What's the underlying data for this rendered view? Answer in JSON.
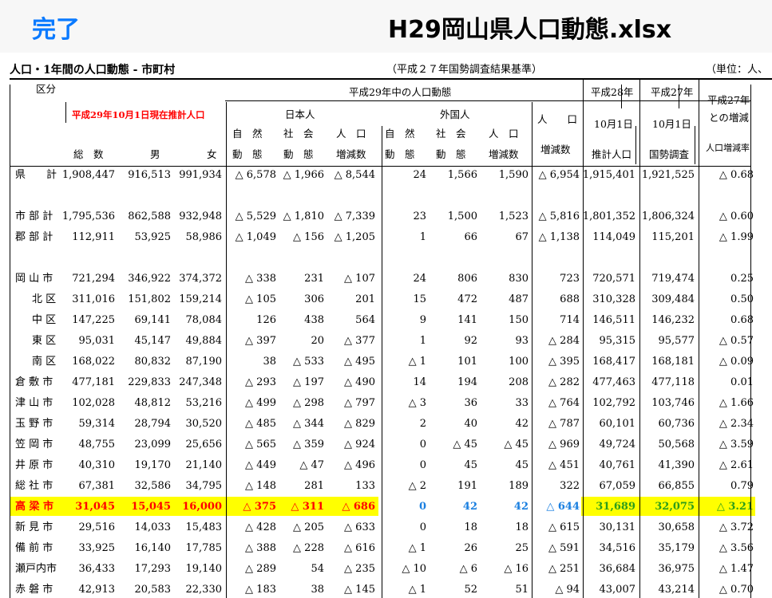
{
  "app": {
    "done_label": "完了",
    "file_title": "H29岡山県人口動態.xlsx"
  },
  "sheet": {
    "title": "人口・1年間の人口動態 - 市町村",
    "basis": "（平成２７年国勢調査結果基準）",
    "unit": "（単位：人、",
    "header": {
      "kubun": "区分",
      "suikei_top": "平成29年10月1日現在推計人口",
      "total": "総　数",
      "male": "男",
      "female": "女",
      "movement_title": "平成29年中の人口動態",
      "japanese": "日本人",
      "foreign": "外国人",
      "shizen_1": "自　然",
      "shizen_2": "動　態",
      "shakai_1": "社　会",
      "shakai_2": "動　態",
      "jinko_1": "人　口",
      "jinko_2": "増減数",
      "jinko_total_1": "人　　口",
      "jinko_total_2": "増減数",
      "h28_1": "平成28年",
      "h28_2": "10月1日",
      "h28_3": "推計人口",
      "h27_1": "平成27年",
      "h27_2": "10月1日",
      "h27_3": "国勢調査",
      "rate_1": "平成27年",
      "rate_2": "との増減",
      "rate_3": "人口増減率"
    },
    "rows": [
      {
        "name": "県　　計",
        "c": [
          "1,908,447",
          "916,513",
          "991,934",
          "△ 6,578",
          "△ 1,966",
          "△ 8,544",
          "24",
          "1,566",
          "1,590",
          "△ 6,954",
          "1,915,401",
          "1,921,525",
          "△ 0.68"
        ]
      },
      {
        "name": "市 部 計",
        "c": [
          "1,795,536",
          "862,588",
          "932,948",
          "△ 5,529",
          "△ 1,810",
          "△ 7,339",
          "23",
          "1,500",
          "1,523",
          "△ 5,816",
          "1,801,352",
          "1,806,324",
          "△ 0.60"
        ]
      },
      {
        "name": "郡 部 計",
        "c": [
          "112,911",
          "53,925",
          "58,986",
          "△ 1,049",
          "△ 156",
          "△ 1,205",
          "1",
          "66",
          "67",
          "△ 1,138",
          "114,049",
          "115,201",
          "△ 1.99"
        ]
      },
      {
        "name": "岡 山 市",
        "c": [
          "721,294",
          "346,922",
          "374,372",
          "△ 338",
          "231",
          "△ 107",
          "24",
          "806",
          "830",
          "723",
          "720,571",
          "719,474",
          "0.25"
        ]
      },
      {
        "name": "北 区",
        "c": [
          "311,016",
          "151,802",
          "159,214",
          "△ 105",
          "306",
          "201",
          "15",
          "472",
          "487",
          "688",
          "310,328",
          "309,484",
          "0.50"
        ]
      },
      {
        "name": "中 区",
        "c": [
          "147,225",
          "69,141",
          "78,084",
          "126",
          "438",
          "564",
          "9",
          "141",
          "150",
          "714",
          "146,511",
          "146,232",
          "0.68"
        ]
      },
      {
        "name": "東 区",
        "c": [
          "95,031",
          "45,147",
          "49,884",
          "△ 397",
          "20",
          "△ 377",
          "1",
          "92",
          "93",
          "△ 284",
          "95,315",
          "95,577",
          "△ 0.57"
        ]
      },
      {
        "name": "南 区",
        "c": [
          "168,022",
          "80,832",
          "87,190",
          "38",
          "△ 533",
          "△ 495",
          "△ 1",
          "101",
          "100",
          "△ 395",
          "168,417",
          "168,181",
          "△ 0.09"
        ]
      },
      {
        "name": "倉 敷 市",
        "c": [
          "477,181",
          "229,833",
          "247,348",
          "△ 293",
          "△ 197",
          "△ 490",
          "14",
          "194",
          "208",
          "△ 282",
          "477,463",
          "477,118",
          "0.01"
        ]
      },
      {
        "name": "津 山 市",
        "c": [
          "102,028",
          "48,812",
          "53,216",
          "△ 499",
          "△ 298",
          "△ 797",
          "△ 3",
          "36",
          "33",
          "△ 764",
          "102,792",
          "103,746",
          "△ 1.66"
        ]
      },
      {
        "name": "玉 野 市",
        "c": [
          "59,314",
          "28,794",
          "30,520",
          "△ 485",
          "△ 344",
          "△ 829",
          "2",
          "40",
          "42",
          "△ 787",
          "60,101",
          "60,736",
          "△ 2.34"
        ]
      },
      {
        "name": "笠 岡 市",
        "c": [
          "48,755",
          "23,099",
          "25,656",
          "△ 565",
          "△ 359",
          "△ 924",
          "0",
          "△ 45",
          "△ 45",
          "△ 969",
          "49,724",
          "50,568",
          "△ 3.59"
        ]
      },
      {
        "name": "井 原 市",
        "c": [
          "40,310",
          "19,170",
          "21,140",
          "△ 449",
          "△ 47",
          "△ 496",
          "0",
          "45",
          "45",
          "△ 451",
          "40,761",
          "41,390",
          "△ 2.61"
        ]
      },
      {
        "name": "総 社 市",
        "c": [
          "67,381",
          "32,586",
          "34,795",
          "△ 148",
          "281",
          "133",
          "△ 2",
          "191",
          "189",
          "322",
          "67,059",
          "66,855",
          "0.79"
        ]
      },
      {
        "name": "高 梁 市",
        "c": [
          "31,045",
          "15,045",
          "16,000",
          "△ 375",
          "△ 311",
          "△ 686",
          "0",
          "42",
          "42",
          "△ 644",
          "31,689",
          "32,075",
          "△ 3.21"
        ],
        "highlight": true
      },
      {
        "name": "新 見 市",
        "c": [
          "29,516",
          "14,033",
          "15,483",
          "△ 428",
          "△ 205",
          "△ 633",
          "0",
          "18",
          "18",
          "△ 615",
          "30,131",
          "30,658",
          "△ 3.72"
        ]
      },
      {
        "name": "備 前 市",
        "c": [
          "33,925",
          "16,140",
          "17,785",
          "△ 388",
          "△ 228",
          "△ 616",
          "△ 1",
          "26",
          "25",
          "△ 591",
          "34,516",
          "35,179",
          "△ 3.56"
        ]
      },
      {
        "name": "瀬戸内市",
        "c": [
          "36,433",
          "17,293",
          "19,140",
          "△ 289",
          "54",
          "△ 235",
          "△ 10",
          "△ 6",
          "△ 16",
          "△ 251",
          "36,684",
          "36,975",
          "△ 1.47"
        ]
      },
      {
        "name": "赤 磐 市",
        "c": [
          "42,913",
          "20,583",
          "22,330",
          "△ 183",
          "38",
          "△ 145",
          "△ 1",
          "52",
          "51",
          "△ 94",
          "43,007",
          "43,214",
          "△ 0.70"
        ]
      }
    ],
    "colors": {
      "highlight_bg": "#ffff00",
      "red": "#ff0000",
      "blue": "#1a7fe0",
      "green": "#2d9e1a",
      "ios_blue": "#0a7aff"
    }
  }
}
